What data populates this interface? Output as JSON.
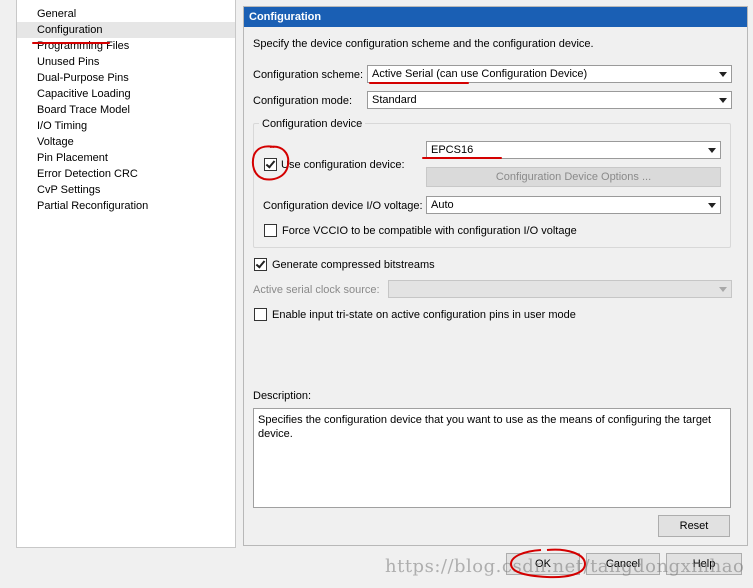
{
  "nav": {
    "items": [
      {
        "label": "General"
      },
      {
        "label": "Configuration",
        "selected": true
      },
      {
        "label": "Programming Files"
      },
      {
        "label": "Unused Pins"
      },
      {
        "label": "Dual-Purpose Pins"
      },
      {
        "label": "Capacitive Loading"
      },
      {
        "label": "Board Trace Model"
      },
      {
        "label": "I/O Timing"
      },
      {
        "label": "Voltage"
      },
      {
        "label": "Pin Placement"
      },
      {
        "label": "Error Detection CRC"
      },
      {
        "label": "CvP Settings"
      },
      {
        "label": "Partial Reconfiguration"
      }
    ]
  },
  "panel": {
    "title": "Configuration",
    "intro": "Specify the device configuration scheme and the configuration device.",
    "scheme_label": "Configuration scheme:",
    "scheme_value": "Active Serial (can use Configuration Device)",
    "mode_label": "Configuration mode:",
    "mode_value": "Standard",
    "group_title": "Configuration device",
    "use_device_label": "Use configuration device:",
    "use_device_checked": true,
    "device_value": "EPCS16",
    "device_options_button": "Configuration Device Options ...",
    "io_voltage_label": "Configuration device I/O voltage:",
    "io_voltage_value": "Auto",
    "force_vccio_label": "Force VCCIO to be compatible with configuration I/O voltage",
    "force_vccio_checked": false,
    "compressed_label": "Generate compressed bitstreams",
    "compressed_checked": true,
    "clock_source_label": "Active serial clock source:",
    "clock_source_value": "",
    "tristate_label": "Enable input tri-state on active configuration pins in user mode",
    "tristate_checked": false,
    "description_label": "Description:",
    "description_text": "Specifies the configuration device that you want to use as the means of configuring the target device.",
    "reset_button": "Reset"
  },
  "footer": {
    "ok_button": "OK",
    "cancel_button": "Cancel",
    "help_button": "Help"
  },
  "watermark": "https://blog.csdn.net/tangdongxinhao",
  "colors": {
    "title_bar": "#1a5fb4",
    "annotation": "#d40000"
  }
}
